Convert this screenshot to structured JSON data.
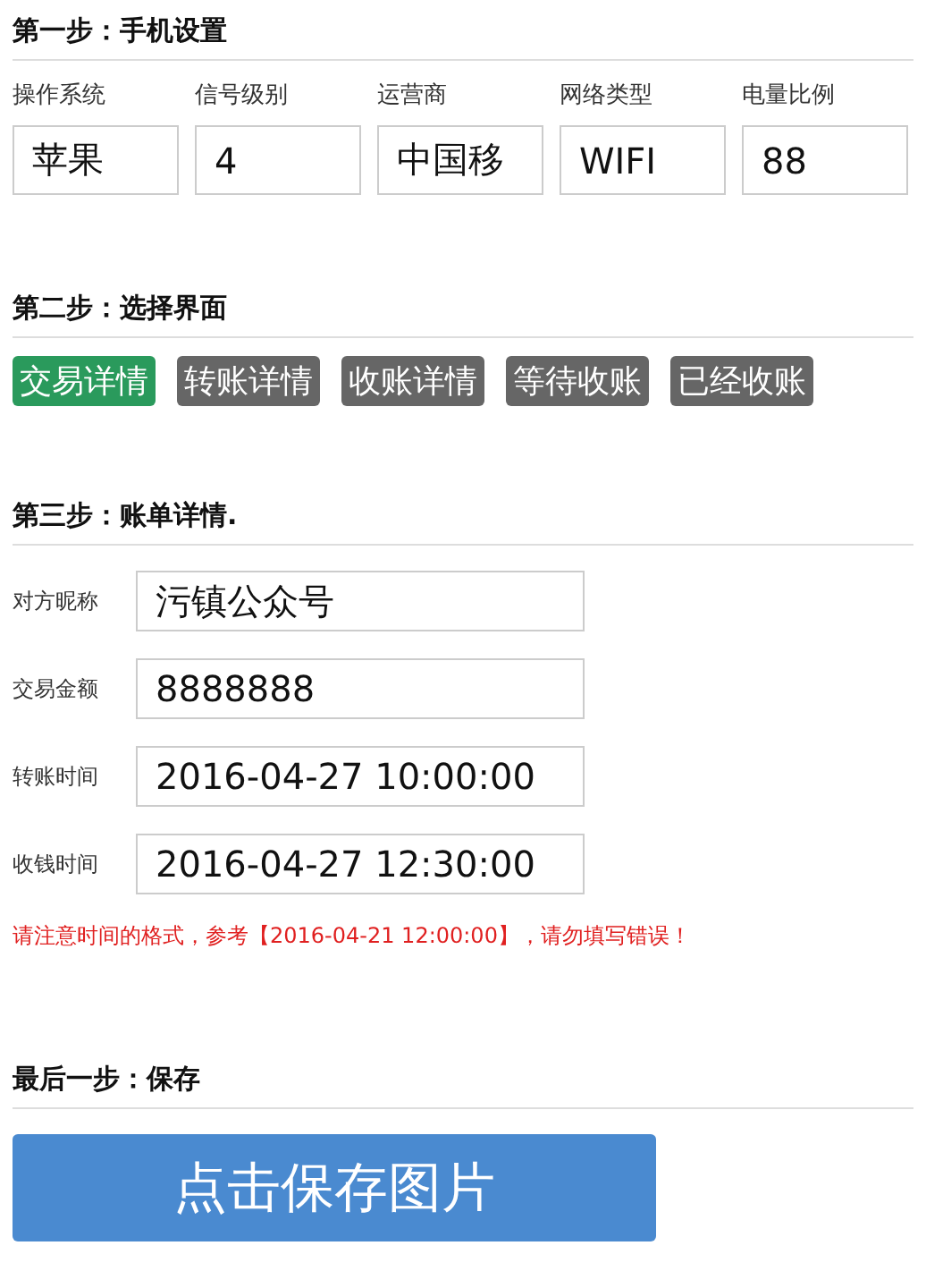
{
  "step1": {
    "title": "第一步：手机设置",
    "fields": [
      {
        "label": "操作系统",
        "value": "苹果"
      },
      {
        "label": "信号级别",
        "value": "4"
      },
      {
        "label": "运营商",
        "value": "中国移"
      },
      {
        "label": "网络类型",
        "value": "WIFI"
      },
      {
        "label": "电量比例",
        "value": "88"
      }
    ]
  },
  "step2": {
    "title": "第二步：选择界面",
    "options": [
      {
        "label": "交易详情",
        "selected": true
      },
      {
        "label": "转账详情",
        "selected": false
      },
      {
        "label": "收账详情",
        "selected": false
      },
      {
        "label": "等待收账",
        "selected": false
      },
      {
        "label": "已经收账",
        "selected": false
      }
    ]
  },
  "step3": {
    "title": "第三步：账单详情.",
    "fields": [
      {
        "label": "对方昵称",
        "value": "污镇公众号"
      },
      {
        "label": "交易金额",
        "value": "8888888"
      },
      {
        "label": "转账时间",
        "value": "2016-04-27 10:00:00"
      },
      {
        "label": "收钱时间",
        "value": "2016-04-27 12:30:00"
      }
    ],
    "warning": "请注意时间的格式，参考【2016-04-21 12:00:00】，请勿填写错误！"
  },
  "final": {
    "title": "最后一步：保存",
    "button": "点击保存图片"
  }
}
